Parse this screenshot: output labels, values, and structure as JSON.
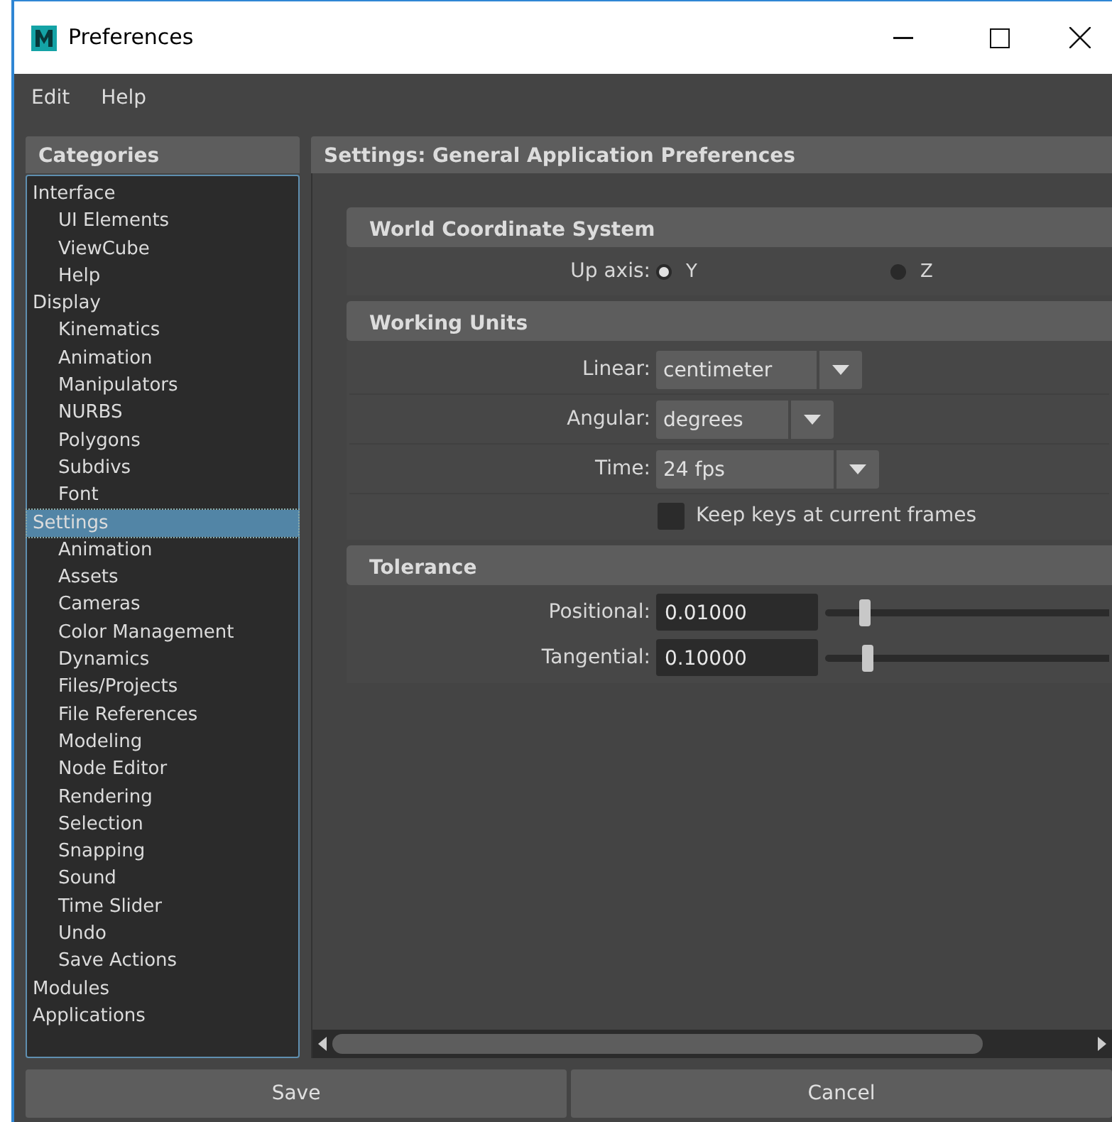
{
  "window": {
    "title": "Preferences"
  },
  "menu": [
    "Edit",
    "Help"
  ],
  "categories": {
    "title": "Categories",
    "items": [
      {
        "label": "Interface",
        "selected": false,
        "children": [
          {
            "label": "UI Elements",
            "selected": false
          },
          {
            "label": "ViewCube",
            "selected": false
          },
          {
            "label": "Help",
            "selected": false
          }
        ]
      },
      {
        "label": "Display",
        "selected": false,
        "children": [
          {
            "label": "Kinematics",
            "selected": false
          },
          {
            "label": "Animation",
            "selected": false
          },
          {
            "label": "Manipulators",
            "selected": false
          },
          {
            "label": "NURBS",
            "selected": false
          },
          {
            "label": "Polygons",
            "selected": false
          },
          {
            "label": "Subdivs",
            "selected": false
          },
          {
            "label": "Font",
            "selected": false
          }
        ]
      },
      {
        "label": "Settings",
        "selected": true,
        "children": [
          {
            "label": "Animation",
            "selected": false
          },
          {
            "label": "Assets",
            "selected": false
          },
          {
            "label": "Cameras",
            "selected": false
          },
          {
            "label": "Color Management",
            "selected": false
          },
          {
            "label": "Dynamics",
            "selected": false
          },
          {
            "label": "Files/Projects",
            "selected": false
          },
          {
            "label": "File References",
            "selected": false
          },
          {
            "label": "Modeling",
            "selected": false
          },
          {
            "label": "Node Editor",
            "selected": false
          },
          {
            "label": "Rendering",
            "selected": false
          },
          {
            "label": "Selection",
            "selected": false
          },
          {
            "label": "Snapping",
            "selected": false
          },
          {
            "label": "Sound",
            "selected": false
          },
          {
            "label": "Time Slider",
            "selected": false
          },
          {
            "label": "Undo",
            "selected": false
          },
          {
            "label": "Save Actions",
            "selected": false
          }
        ]
      },
      {
        "label": "Modules",
        "selected": false
      },
      {
        "label": "Applications",
        "selected": false
      }
    ]
  },
  "settings": {
    "title": "Settings: General Application Preferences",
    "sections": [
      {
        "title": "World Coordinate System",
        "rows": [
          {
            "kind": "radio",
            "label": "Up axis:",
            "options": [
              {
                "label": "Y",
                "selected": true
              },
              {
                "label": "Z",
                "selected": false
              }
            ]
          }
        ]
      },
      {
        "title": "Working Units",
        "rows": [
          {
            "kind": "dropdown",
            "label": "Linear:",
            "value": "centimeter"
          },
          {
            "kind": "dropdown",
            "label": "Angular:",
            "value": "degrees"
          },
          {
            "kind": "dropdown",
            "label": "Time:",
            "value": "24 fps"
          },
          {
            "kind": "checkbox",
            "label": "Keep keys at current frames",
            "checked": false
          }
        ]
      },
      {
        "title": "Tolerance",
        "rows": [
          {
            "kind": "slider",
            "label": "Positional:",
            "value": "0.01000",
            "level": 0.14
          },
          {
            "kind": "slider",
            "label": "Tangential:",
            "value": "0.10000",
            "level": 0.15
          }
        ]
      }
    ]
  },
  "buttons": [
    "Save",
    "Cancel"
  ]
}
